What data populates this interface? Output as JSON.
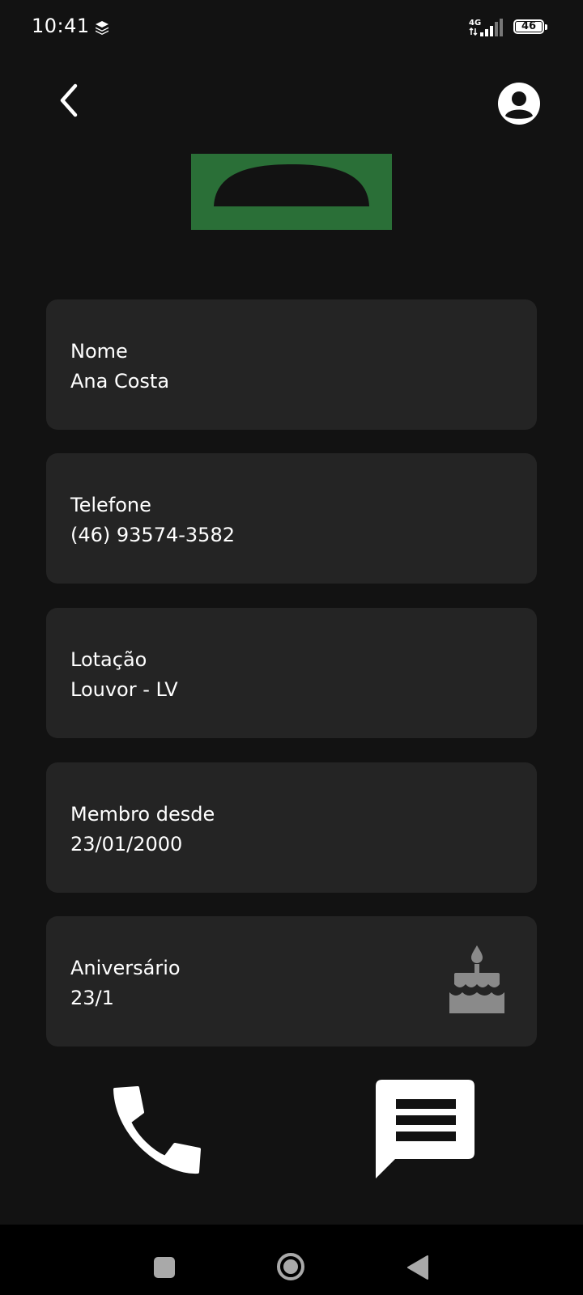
{
  "status_bar": {
    "time": "10:41",
    "network": "4G",
    "battery": "46",
    "icons": [
      "stack-icon",
      "signal-icon",
      "battery-icon"
    ]
  },
  "header": {
    "back_icon": "chevron-left-icon",
    "profile_icon": "account-circle-icon"
  },
  "banner": {
    "color": "#2a6f37"
  },
  "fields": [
    {
      "label": "Nome",
      "value": "Ana Costa"
    },
    {
      "label": "Telefone",
      "value": "(46) 93574-3582"
    },
    {
      "label": "Lotação",
      "value": "Louvor - LV"
    },
    {
      "label": "Membro desde",
      "value": "23/01/2000"
    },
    {
      "label": "Aniversário",
      "value": "23/1",
      "icon": "birthday-cake-icon"
    }
  ],
  "actions": {
    "call_icon": "phone-icon",
    "message_icon": "message-icon"
  },
  "nav_bar": {
    "icons": [
      "recents-square-icon",
      "home-circle-icon",
      "back-triangle-icon"
    ]
  },
  "colors": {
    "background": "#121212",
    "card": "#242424",
    "accent": "#2a6f37",
    "text": "#ffffff",
    "muted_icon": "#8a8a8a"
  }
}
